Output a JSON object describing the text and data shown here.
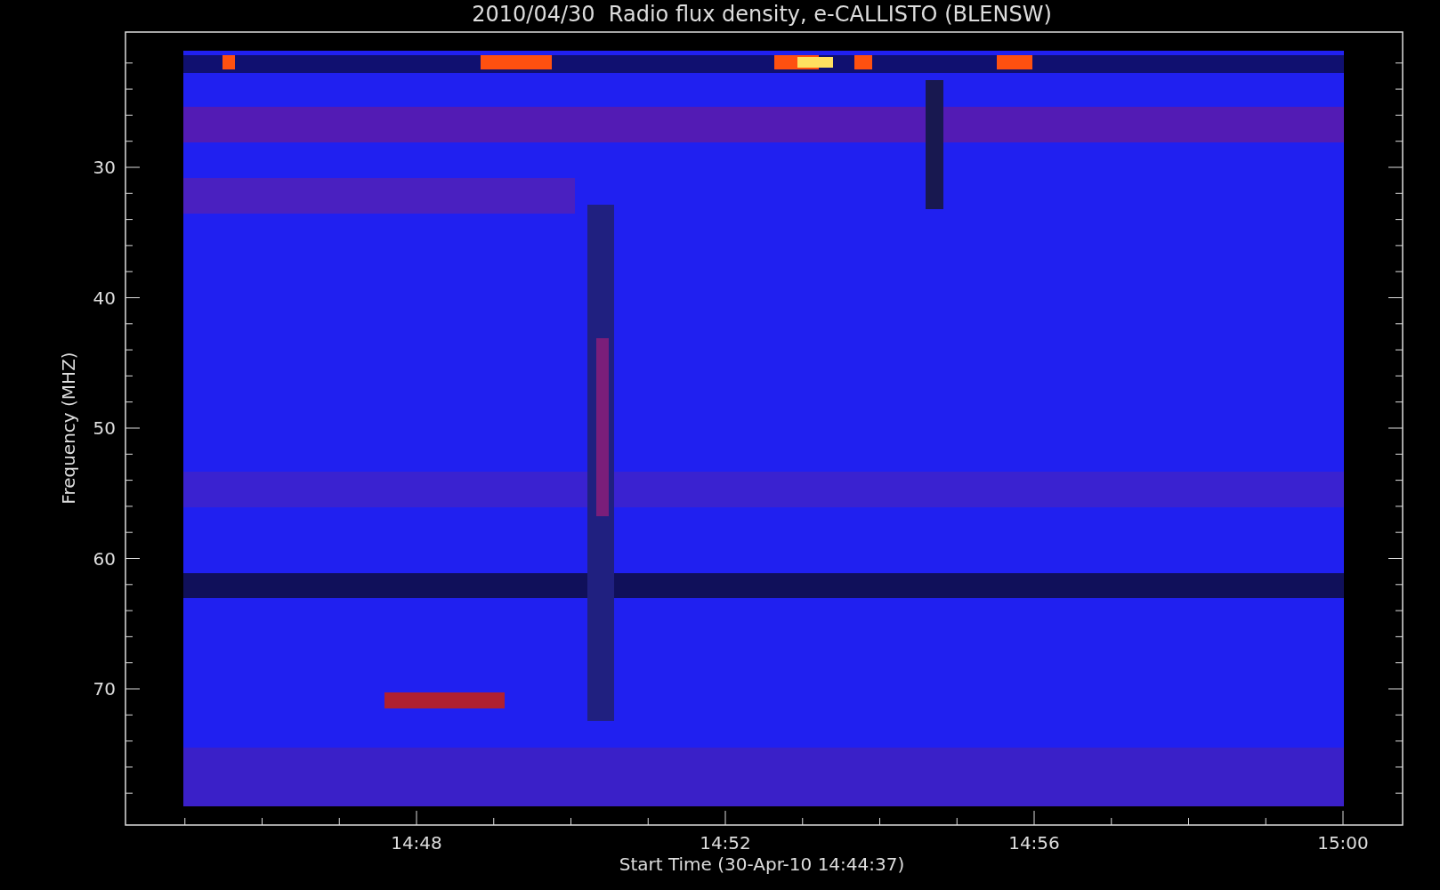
{
  "title": "2010/04/30  Radio flux density, e-CALLISTO (BLENSW)",
  "ylabel": "Frequency (MHZ)",
  "xlabel": "Start Time (30-Apr-10 14:44:37)",
  "yticks": [
    "30",
    "40",
    "50",
    "60",
    "70"
  ],
  "xticks": [
    "14:48",
    "14:52",
    "14:56",
    "15:00"
  ]
}
